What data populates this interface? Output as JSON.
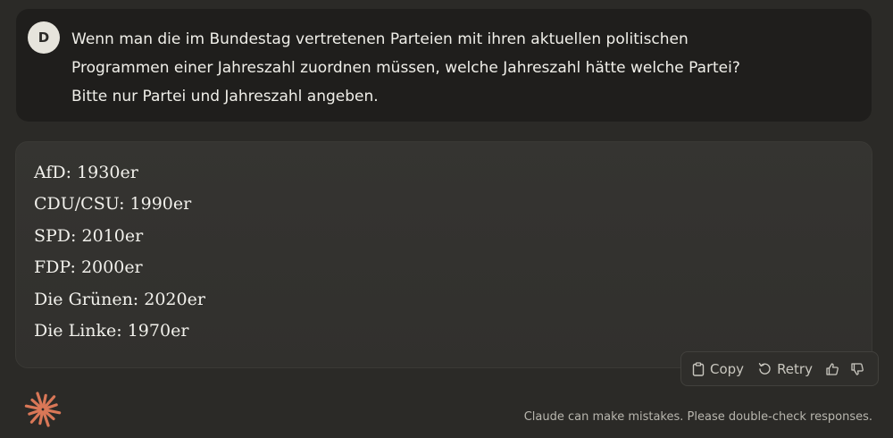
{
  "user_message": {
    "avatar_initial": "D",
    "lines": [
      "Wenn man die im Bundestag vertretenen Parteien mit ihren aktuellen politischen",
      "Programmen einer Jahreszahl zuordnen müssen, welche Jahreszahl hätte welche Partei?",
      "Bitte nur Partei und Jahreszahl angeben."
    ]
  },
  "assistant_message": {
    "lines": [
      "AfD: 1930er",
      "CDU/CSU: 1990er",
      "SPD: 2010er",
      "FDP: 2000er",
      "Die Grünen: 2020er",
      "Die Linke: 1970er"
    ]
  },
  "actions": {
    "copy_label": "Copy",
    "copy_icon": "clipboard-icon",
    "retry_label": "Retry",
    "retry_icon": "retry-icon",
    "thumbs_up_icon": "thumbs-up-icon",
    "thumbs_down_icon": "thumbs-down-icon"
  },
  "footer": {
    "logo_icon": "claude-starburst-icon",
    "disclaimer": "Claude can make mistakes. Please double-check responses."
  },
  "colors": {
    "background": "#2b2a27",
    "user_bubble": "#1f1e1c",
    "assistant_bubble": "#33322f",
    "accent_logo": "#d97757"
  }
}
